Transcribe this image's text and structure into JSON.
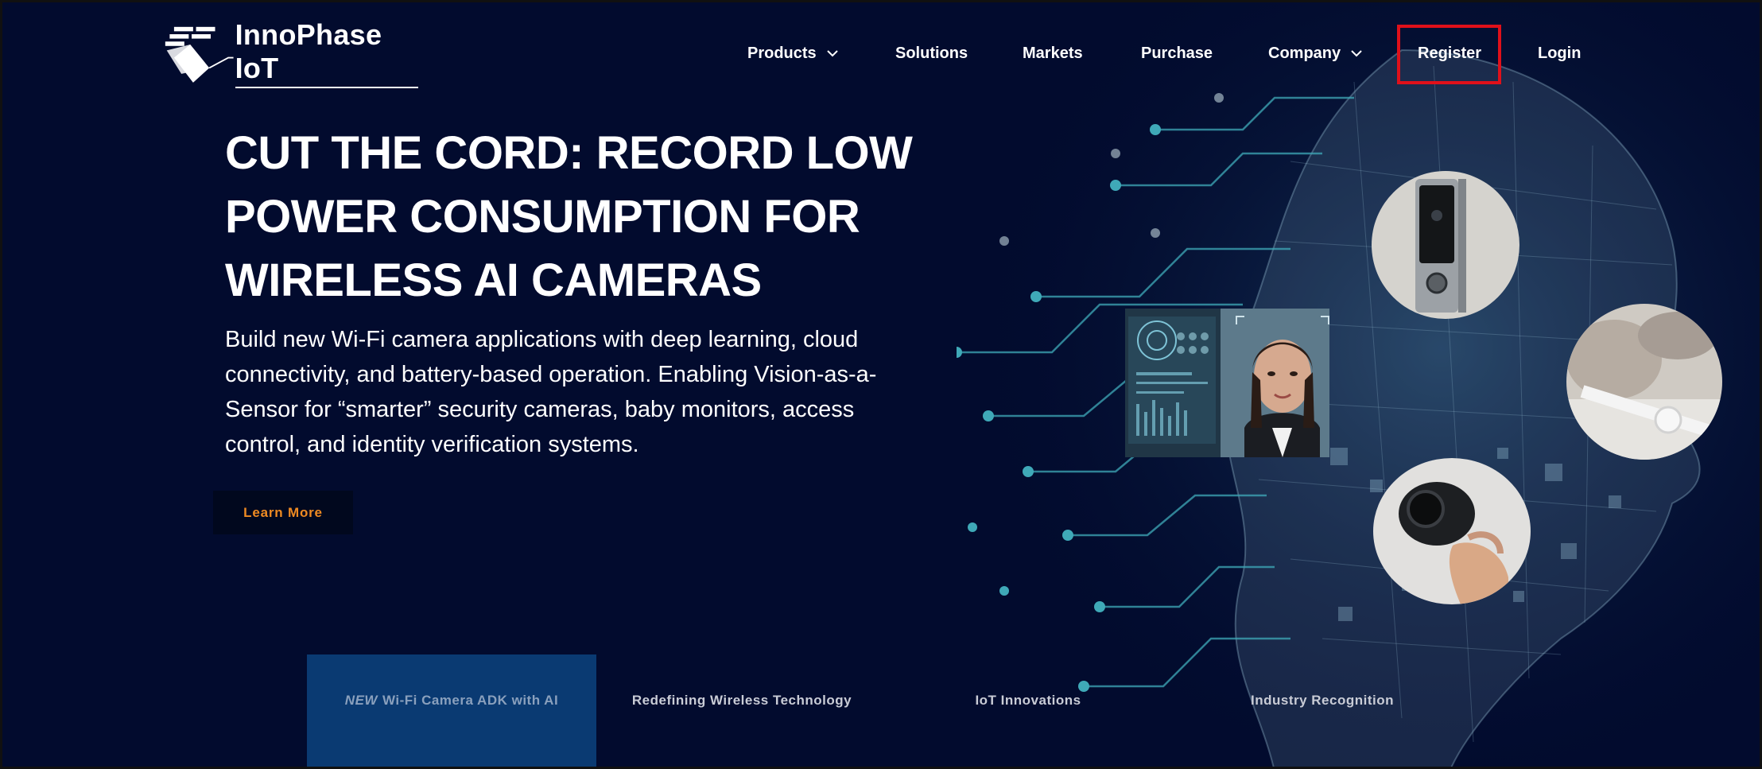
{
  "header": {
    "logo_text": "InnoPhase IoT",
    "nav": [
      {
        "label": "Products",
        "has_dropdown": true
      },
      {
        "label": "Solutions",
        "has_dropdown": false
      },
      {
        "label": "Markets",
        "has_dropdown": false
      },
      {
        "label": "Purchase",
        "has_dropdown": false
      },
      {
        "label": "Company",
        "has_dropdown": true
      },
      {
        "label": "Register",
        "has_dropdown": false
      },
      {
        "label": "Login",
        "has_dropdown": false
      }
    ]
  },
  "hero": {
    "headline_lines": [
      "CUT THE CORD: RECORD LOW",
      "POWER CONSUMPTION FOR",
      "WIRELESS AI CAMERAS"
    ],
    "subtext_lines": [
      "Build new Wi-Fi camera applications with deep learning, cloud",
      "connectivity, and battery-based operation. Enabling Vision-as-a-",
      "Sensor for “smarter” security cameras, baby monitors, access",
      "control, and identity verification systems."
    ],
    "cta_label": "Learn More"
  },
  "tabs": [
    {
      "prefix": "NEW",
      "label": "Wi-Fi Camera ADK with AI",
      "active": true
    },
    {
      "prefix": "",
      "label": "Redefining Wireless Technology",
      "active": false
    },
    {
      "prefix": "",
      "label": "IoT Innovations",
      "active": false
    },
    {
      "prefix": "",
      "label": "Industry Recognition",
      "active": false
    }
  ],
  "colors": {
    "background": "#020b2e",
    "accent_orange": "#ee8a22",
    "active_tab": "#0a3a72",
    "highlight_red": "#e0101a",
    "circuit_teal": "#3fa9b8"
  },
  "icons": {
    "logo": "innophase-logo-icon",
    "dropdown": "chevron-down-icon"
  }
}
